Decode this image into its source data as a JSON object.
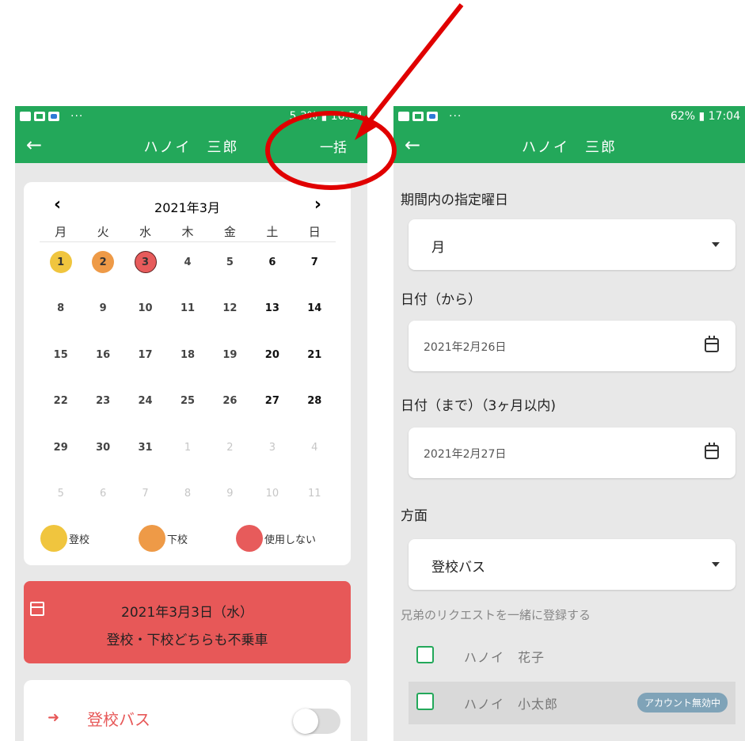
{
  "left_screen": {
    "status_bar": {
      "right_text": "5 3% ▮ 16:54"
    },
    "app_bar": {
      "back_icon": "back-arrow-icon",
      "title": "ハノイ　三郎",
      "action_label": "一括"
    },
    "calendar": {
      "prev_icon": "chevron-left-icon",
      "next_icon": "chevron-right-icon",
      "month_label": "2021年3月",
      "weekdays": [
        "月",
        "火",
        "水",
        "木",
        "金",
        "土",
        "日"
      ],
      "weeks": [
        [
          "1",
          "2",
          "3",
          "4",
          "5",
          "6",
          "7"
        ],
        [
          "8",
          "9",
          "10",
          "11",
          "12",
          "13",
          "14"
        ],
        [
          "15",
          "16",
          "17",
          "18",
          "19",
          "20",
          "21"
        ],
        [
          "22",
          "23",
          "24",
          "25",
          "26",
          "27",
          "28"
        ],
        [
          "29",
          "30",
          "31",
          "1",
          "2",
          "3",
          "4"
        ],
        [
          "5",
          "6",
          "7",
          "8",
          "9",
          "10",
          "11"
        ]
      ],
      "status_days": {
        "1": "attend",
        "2": "leave",
        "3": "none"
      },
      "legend": [
        {
          "label": "登校",
          "color": "#f0c53e"
        },
        {
          "label": "下校",
          "color": "#ee9a47"
        },
        {
          "label": "使用しない",
          "color": "#e75b5b"
        }
      ]
    },
    "selected_banner": {
      "icon": "calendar-icon",
      "date": "2021年3月3日（水）",
      "status": "登校・下校どちらも不乗車"
    },
    "bus_row": {
      "icon": "arrow-right-icon",
      "label": "登校バス",
      "toggle_on": false
    }
  },
  "right_screen": {
    "status_bar": {
      "right_text": "62% ▮ 17:04"
    },
    "app_bar": {
      "back_icon": "back-arrow-icon",
      "title": "ハノイ　三郎"
    },
    "form": {
      "weekday_label": "期間内の指定曜日",
      "weekday_value": "月",
      "date_from_label": "日付（から）",
      "date_from_value": "2021年2月26日",
      "date_to_label": "日付（まで）（3ヶ月以内)",
      "date_to_value": "2021年2月27日",
      "direction_label": "方面",
      "direction_value": "登校バス",
      "siblings_label": "兄弟のリクエストを一緒に登録する",
      "siblings": [
        {
          "name": "ハノイ　花子",
          "badge": ""
        },
        {
          "name": "ハノイ　小太郎",
          "badge": "アカウント無効中"
        }
      ]
    }
  },
  "colors": {
    "primary_green": "#23a85a",
    "annotation_red": "#e00000",
    "alert_red": "#e75858"
  }
}
